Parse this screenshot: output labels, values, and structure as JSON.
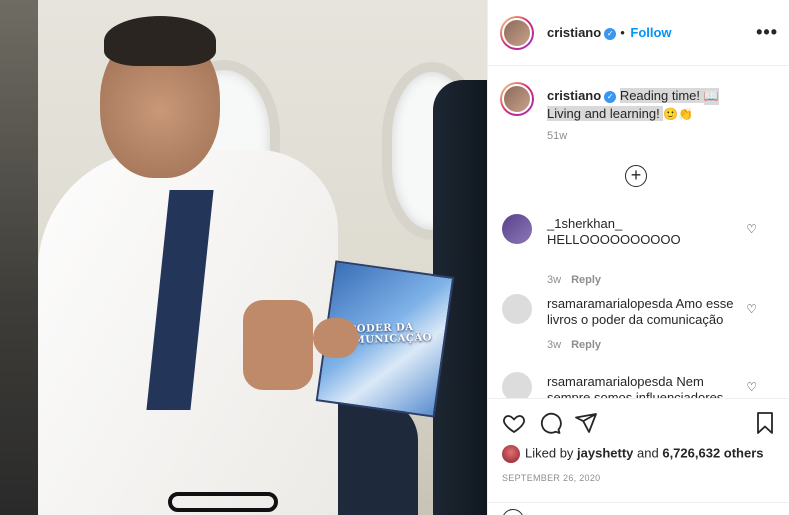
{
  "post": {
    "username": "cristiano",
    "verified_icon": "verified-badge-icon",
    "separator": "•",
    "follow_label": "Follow",
    "more_icon": "ellipsis-icon",
    "more_label": "•••",
    "caption_line1": "Reading time! ",
    "caption_emoji1": "📖",
    "caption_line2": "Living and learning! ",
    "caption_emoji2": "🙂👏",
    "caption_time": "51w",
    "load_more_label": "+",
    "book_title": "O PODER DA COMUNICAÇÃO"
  },
  "comments": [
    {
      "username": "_1sherkhan_",
      "text": "HELLOOOOOOOOOO",
      "time": "3w",
      "reply": "Reply",
      "avatar_color": "#3a3f6a"
    },
    {
      "username": "rsamaramarialopesda",
      "text": "Amo esse livros o poder da comunicação",
      "time": "3w",
      "reply": "Reply",
      "avatar_color": "#d8d8d8"
    },
    {
      "username": "rsamaramarialopesda",
      "text": "Nem sempre somos influenciadores de",
      "time": "",
      "reply": "",
      "avatar_color": "#d8d8d8"
    }
  ],
  "actions": {
    "like_icon": "heart-icon",
    "comment_icon": "comment-icon",
    "share_icon": "send-icon",
    "save_icon": "bookmark-icon"
  },
  "likes": {
    "prefix": "Liked by ",
    "user": "jayshetty",
    "middle": " and ",
    "count": "6,726,632 others"
  },
  "date": "SEPTEMBER 26, 2020",
  "colors": {
    "follow": "#0095f6",
    "verified": "#3897f0",
    "muted": "#8e8e8e"
  }
}
